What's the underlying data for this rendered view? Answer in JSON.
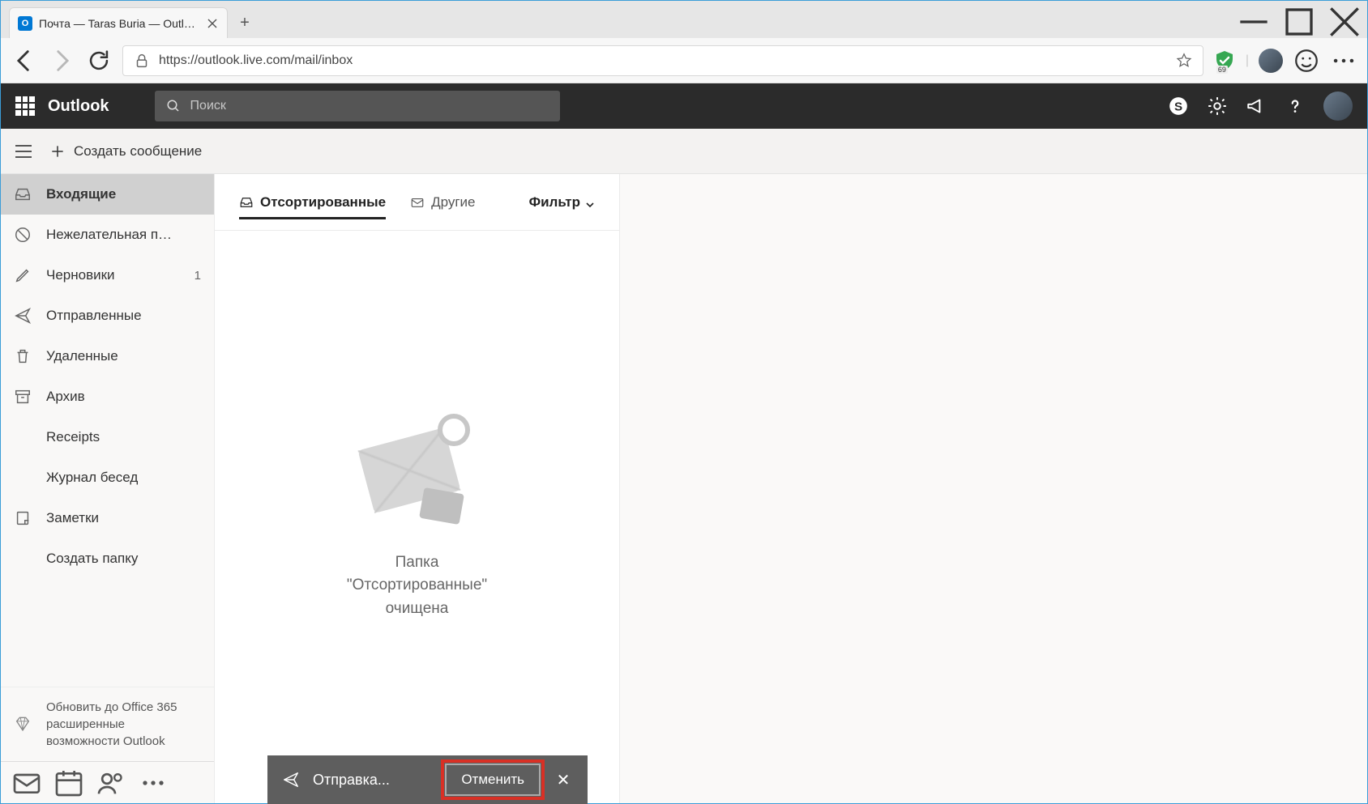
{
  "browser": {
    "tab_title": "Почта — Taras Buria — Outlook",
    "url": "https://outlook.live.com/mail/inbox",
    "extension_badge": "69"
  },
  "header": {
    "brand": "Outlook",
    "search_placeholder": "Поиск"
  },
  "commands": {
    "compose": "Создать сообщение"
  },
  "sidebar": {
    "folders": [
      {
        "id": "inbox",
        "label": "Входящие",
        "icon": "inbox",
        "active": true
      },
      {
        "id": "junk",
        "label": "Нежелательная п…",
        "icon": "block"
      },
      {
        "id": "drafts",
        "label": "Черновики",
        "icon": "pencil",
        "count": "1"
      },
      {
        "id": "sent",
        "label": "Отправленные",
        "icon": "send"
      },
      {
        "id": "deleted",
        "label": "Удаленные",
        "icon": "trash"
      },
      {
        "id": "archive",
        "label": "Архив",
        "icon": "archive"
      },
      {
        "id": "receipts",
        "label": "Receipts",
        "icon": ""
      },
      {
        "id": "chatlog",
        "label": "Журнал бесед",
        "icon": ""
      },
      {
        "id": "notes",
        "label": "Заметки",
        "icon": "note"
      },
      {
        "id": "newfolder",
        "label": "Создать папку",
        "icon": ""
      }
    ],
    "upgrade": "Обновить до Office 365 расширенные возможности Outlook"
  },
  "list": {
    "tab_focused": "Отсортированные",
    "tab_other": "Другие",
    "filter": "Фильтр",
    "empty_line1": "Папка",
    "empty_line2": "\"Отсортированные\"",
    "empty_line3": "очищена"
  },
  "toast": {
    "message": "Отправка...",
    "cancel": "Отменить"
  }
}
